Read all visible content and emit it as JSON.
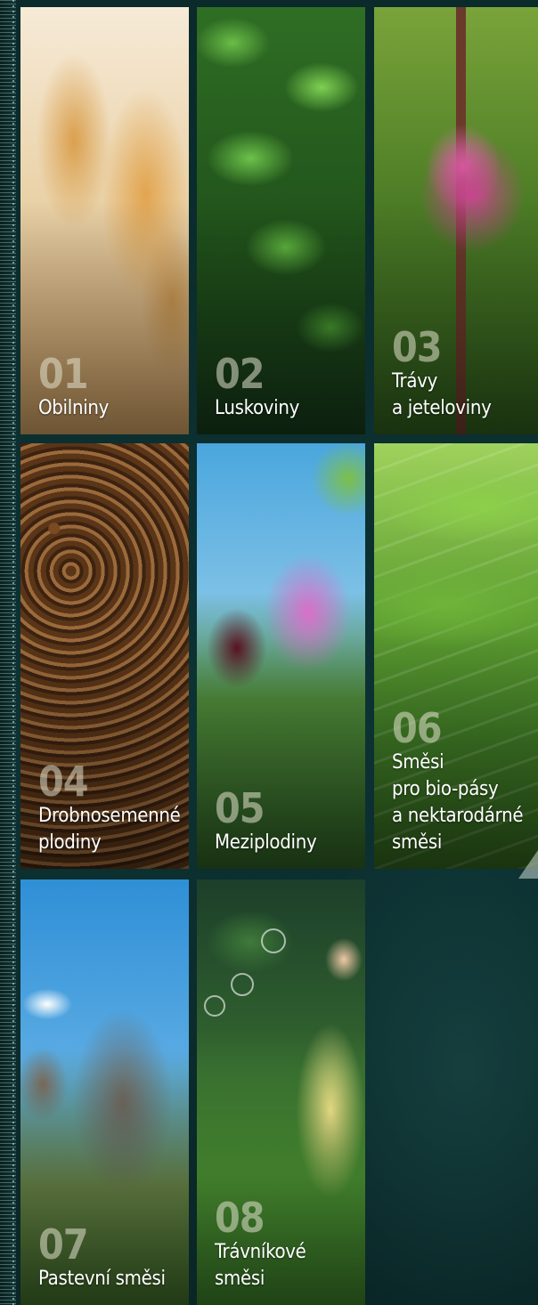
{
  "tiles": [
    {
      "number": "01",
      "label": "Obilniny"
    },
    {
      "number": "02",
      "label": "Luskoviny"
    },
    {
      "number": "03",
      "label": "Trávy\na jeteloviny"
    },
    {
      "number": "04",
      "label": "Drobnosemenné\nplodiny"
    },
    {
      "number": "05",
      "label": "Meziplodiny"
    },
    {
      "number": "06",
      "label": "Směsi\npro bio-pásy\na nektarodárné\nsměsi"
    },
    {
      "number": "07",
      "label": "Pastevní směsi"
    },
    {
      "number": "08",
      "label": "Trávníkové\nsměsi"
    }
  ]
}
